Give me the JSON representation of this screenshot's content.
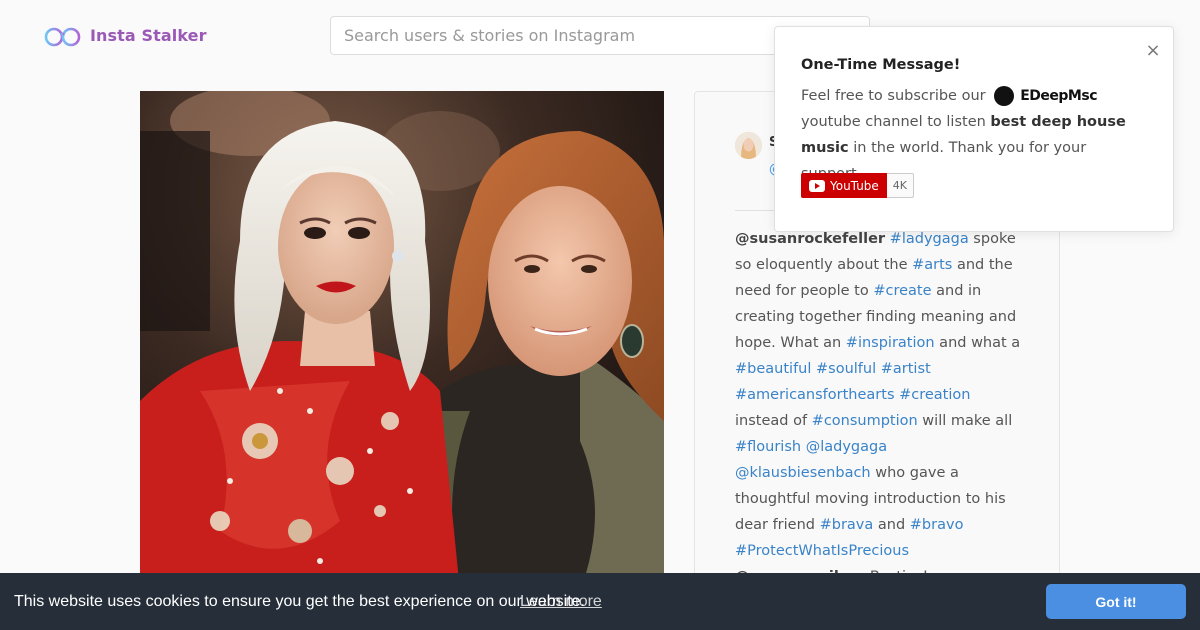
{
  "header": {
    "logo_text": "Insta Stalker",
    "search_placeholder": "Search users & stories on Instagram"
  },
  "post": {
    "user_name": "S",
    "user_handle": "@",
    "caption_parts": [
      {
        "t": "@susanrockefeller",
        "k": "men"
      },
      {
        "t": " ",
        "k": "txt"
      },
      {
        "t": "#ladygaga",
        "k": "tag"
      },
      {
        "t": " spoke so eloquently about the ",
        "k": "txt"
      },
      {
        "t": "#arts",
        "k": "tag"
      },
      {
        "t": " and the need for people to ",
        "k": "txt"
      },
      {
        "t": "#create",
        "k": "tag"
      },
      {
        "t": " and in creating together finding meaning and hope. What an ",
        "k": "txt"
      },
      {
        "t": "#inspiration",
        "k": "tag"
      },
      {
        "t": " and what a ",
        "k": "txt"
      },
      {
        "t": "#beautiful",
        "k": "tag"
      },
      {
        "t": " ",
        "k": "txt"
      },
      {
        "t": "#soulful",
        "k": "tag"
      },
      {
        "t": " ",
        "k": "txt"
      },
      {
        "t": "#artist",
        "k": "tag"
      },
      {
        "t": " ",
        "k": "txt"
      },
      {
        "t": "#americansforthearts",
        "k": "tag"
      },
      {
        "t": " ",
        "k": "txt"
      },
      {
        "t": "#creation",
        "k": "tag"
      },
      {
        "t": " instead of ",
        "k": "txt"
      },
      {
        "t": "#consumption",
        "k": "tag"
      },
      {
        "t": " will make all ",
        "k": "txt"
      },
      {
        "t": "#flourish",
        "k": "tag"
      },
      {
        "t": " ",
        "k": "txt"
      },
      {
        "t": "@ladygaga",
        "k": "tag"
      },
      {
        "t": " ",
        "k": "txt"
      },
      {
        "t": "@klausbiesenbach",
        "k": "tag"
      },
      {
        "t": " who gave a thoughtful moving introduction to his dear friend ",
        "k": "txt"
      },
      {
        "t": "#brava",
        "k": "tag"
      },
      {
        "t": " and ",
        "k": "txt"
      },
      {
        "t": "#bravo",
        "k": "tag"
      },
      {
        "t": " ",
        "k": "txt"
      },
      {
        "t": "#ProtectWhatIsPrecious",
        "k": "tag"
      },
      {
        "t": "\n",
        "k": "br"
      },
      {
        "t": "@cameronsilver",
        "k": "men"
      },
      {
        "t": " Besties!",
        "k": "txt"
      }
    ]
  },
  "popup": {
    "title": "One-Time Message!",
    "text_before": "Feel free to subscribe our",
    "brand": "EDeepMsc",
    "text_after_brand": "youtube channel to listen",
    "bold_text": "best deep house music",
    "text_end": "in the world. Thank you for your support.",
    "close_symbol": "×",
    "youtube_label": "YouTube",
    "youtube_count": "4K"
  },
  "cookie": {
    "message": "This website uses cookies to ensure you get the best experience on our website.",
    "learn_more": "Learn more",
    "button": "Got it!"
  },
  "colors": {
    "brand_purple": "#9b59b6",
    "link_blue": "#3a83c8",
    "cookie_bg": "#252e39",
    "cookie_button": "#4b8fe2",
    "youtube_red": "#cc0000"
  }
}
